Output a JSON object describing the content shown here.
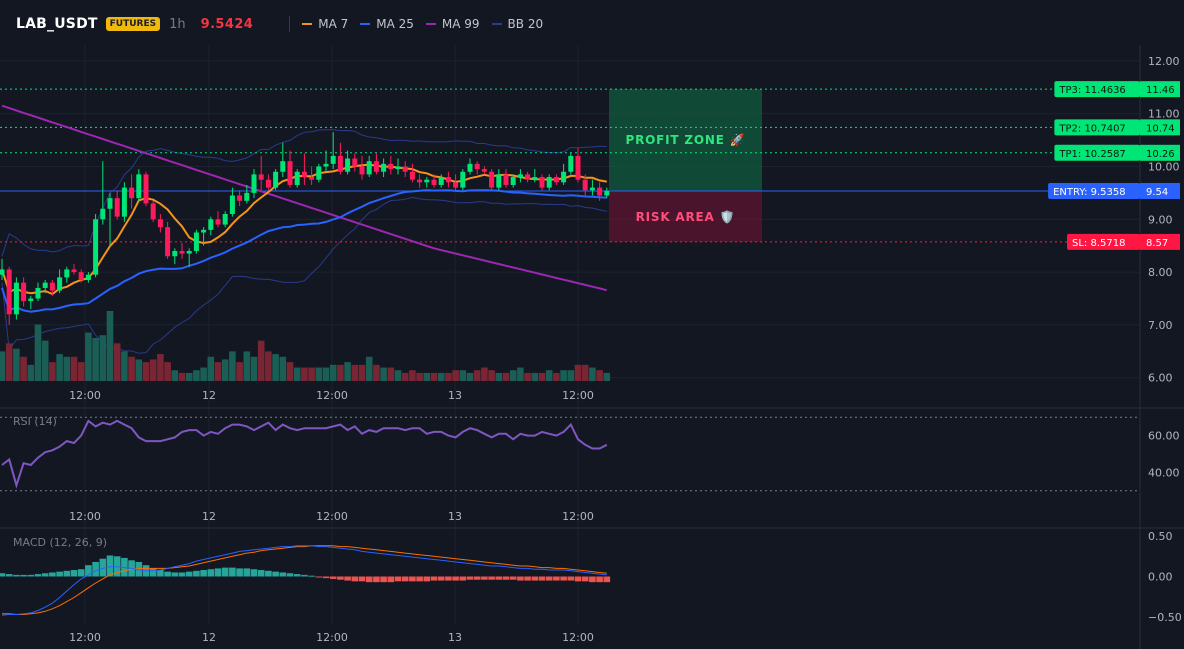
{
  "header": {
    "symbol": "LAB_USDT",
    "badge": "FUTURES",
    "timeframe": "1h",
    "last_price": "9.5424",
    "legend": [
      {
        "label": "MA 7",
        "color": "#f7931a"
      },
      {
        "label": "MA 25",
        "color": "#2962ff"
      },
      {
        "label": "MA 99",
        "color": "#9c27b0"
      },
      {
        "label": "BB 20",
        "color": "#2a3a8c"
      }
    ]
  },
  "colors": {
    "background": "#131722",
    "up": "#26a69a",
    "down": "#f23645",
    "up_bright": "#00e676",
    "down_bright": "#ff1a5c",
    "tp": "#00e676",
    "entry": "#2962ff",
    "sl": "#ff1744"
  },
  "zones": {
    "profit": "PROFIT ZONE 🚀",
    "risk": "RISK AREA 🛡️"
  },
  "levels": [
    {
      "name": "tp3",
      "label": "TP3: 11.4636",
      "value": 11.4636,
      "axis_label": "11.46",
      "kind": "tp"
    },
    {
      "name": "tp2",
      "label": "TP2: 10.7407",
      "value": 10.7407,
      "axis_label": "10.74",
      "kind": "tp"
    },
    {
      "name": "tp1",
      "label": "TP1: 10.2587",
      "value": 10.2587,
      "axis_label": "10.26",
      "kind": "tp"
    },
    {
      "name": "entry",
      "label": "ENTRY: 9.5358",
      "value": 9.5358,
      "axis_label": "9.54",
      "kind": "entry"
    },
    {
      "name": "sl",
      "label": "SL: 8.5718",
      "value": 8.5718,
      "axis_label": "8.57",
      "kind": "sl"
    }
  ],
  "price_axis": {
    "ticks": [
      "12.00",
      "11.00",
      "10.00",
      "9.00",
      "8.00",
      "7.00",
      "6.00"
    ],
    "range": [
      5.9,
      12.3
    ]
  },
  "time_axis": {
    "ticks": [
      "12:00",
      "12",
      "12:00",
      "13",
      "12:00"
    ]
  },
  "rsi": {
    "title": "RSI (14)",
    "ticks": [
      "60.00",
      "40.00"
    ],
    "range": [
      25,
      75
    ],
    "bands": [
      70,
      30
    ]
  },
  "macd": {
    "title": "MACD (12, 26, 9)",
    "ticks": [
      "0.50",
      "0.00",
      "−0.50"
    ],
    "range": [
      -0.6,
      0.6
    ]
  },
  "chart_data": {
    "type": "candlestick",
    "candles": [
      [
        7.95,
        8.25,
        7.85,
        8.05,
        0.55
      ],
      [
        8.05,
        8.1,
        7.0,
        7.2,
        0.7
      ],
      [
        7.2,
        7.9,
        7.1,
        7.8,
        0.6
      ],
      [
        7.8,
        7.9,
        7.35,
        7.45,
        0.45
      ],
      [
        7.45,
        7.55,
        7.3,
        7.5,
        0.3
      ],
      [
        7.5,
        7.8,
        7.45,
        7.7,
        1.05
      ],
      [
        7.7,
        7.85,
        7.6,
        7.8,
        0.75
      ],
      [
        7.8,
        7.85,
        7.55,
        7.65,
        0.35
      ],
      [
        7.65,
        8.05,
        7.6,
        7.9,
        0.5
      ],
      [
        7.9,
        8.1,
        7.8,
        8.05,
        0.45
      ],
      [
        8.05,
        8.15,
        7.95,
        8.0,
        0.45
      ],
      [
        8.0,
        8.05,
        7.8,
        7.85,
        0.35
      ],
      [
        7.85,
        8.0,
        7.8,
        7.95,
        0.9
      ],
      [
        7.95,
        9.1,
        7.9,
        9.0,
        0.8
      ],
      [
        9.0,
        10.1,
        8.9,
        9.2,
        0.85
      ],
      [
        9.2,
        9.5,
        8.5,
        9.4,
        1.3
      ],
      [
        9.4,
        9.55,
        9.0,
        9.05,
        0.7
      ],
      [
        9.05,
        9.7,
        8.95,
        9.6,
        0.55
      ],
      [
        9.6,
        9.85,
        9.2,
        9.4,
        0.45
      ],
      [
        9.4,
        9.95,
        9.35,
        9.85,
        0.4
      ],
      [
        9.85,
        9.9,
        9.25,
        9.3,
        0.35
      ],
      [
        9.3,
        9.35,
        8.95,
        9.0,
        0.4
      ],
      [
        9.0,
        9.1,
        8.75,
        8.85,
        0.5
      ],
      [
        8.85,
        8.95,
        8.25,
        8.3,
        0.35
      ],
      [
        8.3,
        8.45,
        8.15,
        8.4,
        0.2
      ],
      [
        8.4,
        8.55,
        8.25,
        8.35,
        0.15
      ],
      [
        8.35,
        8.45,
        8.1,
        8.4,
        0.15
      ],
      [
        8.4,
        8.8,
        8.35,
        8.75,
        0.2
      ],
      [
        8.75,
        8.85,
        8.5,
        8.8,
        0.25
      ],
      [
        8.8,
        9.05,
        8.7,
        9.0,
        0.45
      ],
      [
        9.0,
        9.15,
        8.85,
        8.9,
        0.35
      ],
      [
        8.9,
        9.15,
        8.85,
        9.1,
        0.4
      ],
      [
        9.1,
        9.6,
        9.05,
        9.45,
        0.55
      ],
      [
        9.45,
        9.55,
        9.25,
        9.35,
        0.35
      ],
      [
        9.35,
        9.65,
        9.3,
        9.5,
        0.55
      ],
      [
        9.5,
        9.95,
        9.4,
        9.85,
        0.45
      ],
      [
        9.85,
        10.2,
        9.55,
        9.75,
        0.75
      ],
      [
        9.75,
        9.85,
        9.55,
        9.6,
        0.55
      ],
      [
        9.6,
        9.95,
        9.55,
        9.9,
        0.5
      ],
      [
        9.9,
        10.45,
        9.8,
        10.1,
        0.45
      ],
      [
        10.1,
        10.3,
        9.6,
        9.65,
        0.35
      ],
      [
        9.65,
        9.95,
        9.6,
        9.9,
        0.25
      ],
      [
        9.9,
        10.25,
        9.65,
        9.8,
        0.25
      ],
      [
        9.8,
        10.0,
        9.65,
        9.75,
        0.25
      ],
      [
        9.75,
        10.05,
        9.7,
        10.0,
        0.25
      ],
      [
        10.0,
        10.3,
        9.9,
        10.05,
        0.25
      ],
      [
        10.05,
        10.65,
        9.95,
        10.2,
        0.3
      ],
      [
        10.2,
        10.45,
        9.85,
        9.9,
        0.3
      ],
      [
        9.9,
        10.3,
        9.85,
        10.15,
        0.35
      ],
      [
        10.15,
        10.25,
        9.9,
        10.0,
        0.3
      ],
      [
        10.0,
        10.2,
        9.75,
        9.85,
        0.3
      ],
      [
        9.85,
        10.2,
        9.8,
        10.1,
        0.45
      ],
      [
        10.1,
        10.25,
        9.85,
        9.9,
        0.3
      ],
      [
        9.9,
        10.15,
        9.8,
        10.05,
        0.25
      ],
      [
        10.05,
        10.2,
        9.85,
        9.95,
        0.25
      ],
      [
        9.95,
        10.15,
        9.85,
        10.0,
        0.2
      ],
      [
        10.0,
        10.1,
        9.8,
        9.9,
        0.15
      ],
      [
        9.9,
        10.05,
        9.7,
        9.75,
        0.2
      ],
      [
        9.75,
        9.85,
        9.6,
        9.7,
        0.15
      ],
      [
        9.7,
        9.8,
        9.6,
        9.75,
        0.15
      ],
      [
        9.75,
        9.85,
        9.6,
        9.65,
        0.15
      ],
      [
        9.65,
        9.85,
        9.6,
        9.8,
        0.15
      ],
      [
        9.8,
        9.9,
        9.6,
        9.7,
        0.15
      ],
      [
        9.7,
        9.85,
        9.55,
        9.6,
        0.2
      ],
      [
        9.6,
        9.95,
        9.55,
        9.9,
        0.2
      ],
      [
        9.9,
        10.15,
        9.85,
        10.05,
        0.15
      ],
      [
        10.05,
        10.1,
        9.85,
        9.95,
        0.2
      ],
      [
        9.95,
        10.0,
        9.85,
        9.9,
        0.25
      ],
      [
        9.9,
        9.95,
        9.55,
        9.6,
        0.2
      ],
      [
        9.6,
        9.95,
        9.55,
        9.85,
        0.15
      ],
      [
        9.85,
        9.95,
        9.6,
        9.65,
        0.15
      ],
      [
        9.65,
        9.85,
        9.6,
        9.8,
        0.2
      ],
      [
        9.8,
        9.95,
        9.7,
        9.85,
        0.25
      ],
      [
        9.85,
        9.9,
        9.7,
        9.75,
        0.15
      ],
      [
        9.75,
        9.95,
        9.7,
        9.8,
        0.15
      ],
      [
        9.8,
        9.85,
        9.55,
        9.6,
        0.15
      ],
      [
        9.6,
        9.85,
        9.55,
        9.8,
        0.2
      ],
      [
        9.8,
        9.85,
        9.65,
        9.7,
        0.15
      ],
      [
        9.7,
        10.05,
        9.65,
        9.9,
        0.2
      ],
      [
        9.9,
        10.25,
        9.85,
        10.2,
        0.2
      ],
      [
        10.2,
        10.35,
        9.7,
        9.75,
        0.3
      ],
      [
        9.75,
        9.85,
        9.45,
        9.55,
        0.3
      ],
      [
        9.55,
        9.75,
        9.45,
        9.6,
        0.25
      ],
      [
        9.6,
        9.7,
        9.35,
        9.45,
        0.2
      ],
      [
        9.45,
        9.6,
        9.4,
        9.54,
        0.15
      ]
    ],
    "rsi": [
      44,
      47,
      33,
      45,
      44,
      48,
      51,
      52,
      54,
      57,
      56,
      60,
      68,
      65,
      67,
      66,
      68,
      66,
      64,
      59,
      57,
      57,
      57,
      58,
      59,
      62,
      63,
      63,
      60,
      62,
      61,
      64,
      66,
      66,
      65,
      63,
      65,
      67,
      63,
      66,
      64,
      63,
      64,
      64,
      64,
      64,
      65,
      66,
      63,
      65,
      61,
      63,
      62,
      64,
      64,
      64,
      63,
      64,
      64,
      61,
      62,
      62,
      60,
      59,
      62,
      64,
      63,
      61,
      59,
      61,
      61,
      58,
      61,
      60,
      60,
      62,
      61,
      60,
      62,
      66,
      58,
      55,
      53,
      53,
      55
    ],
    "macd_hist": [
      0.04,
      0.03,
      0.02,
      0.02,
      0.02,
      0.03,
      0.04,
      0.05,
      0.06,
      0.07,
      0.08,
      0.09,
      0.14,
      0.18,
      0.22,
      0.26,
      0.25,
      0.23,
      0.2,
      0.18,
      0.14,
      0.1,
      0.08,
      0.06,
      0.05,
      0.05,
      0.06,
      0.07,
      0.08,
      0.09,
      0.1,
      0.11,
      0.11,
      0.1,
      0.1,
      0.09,
      0.08,
      0.07,
      0.06,
      0.05,
      0.04,
      0.03,
      0.02,
      0.01,
      -0.01,
      -0.02,
      -0.03,
      -0.04,
      -0.05,
      -0.06,
      -0.06,
      -0.07,
      -0.07,
      -0.07,
      -0.07,
      -0.06,
      -0.06,
      -0.06,
      -0.06,
      -0.06,
      -0.05,
      -0.05,
      -0.05,
      -0.05,
      -0.05,
      -0.04,
      -0.04,
      -0.04,
      -0.04,
      -0.04,
      -0.04,
      -0.04,
      -0.05,
      -0.05,
      -0.05,
      -0.05,
      -0.05,
      -0.05,
      -0.05,
      -0.05,
      -0.06,
      -0.06,
      -0.07,
      -0.07,
      -0.07
    ],
    "macd_line": [
      -0.48,
      -0.47,
      -0.47,
      -0.46,
      -0.45,
      -0.42,
      -0.38,
      -0.33,
      -0.26,
      -0.18,
      -0.1,
      -0.03,
      0.02,
      0.07,
      0.1,
      0.12,
      0.12,
      0.11,
      0.1,
      0.08,
      0.07,
      0.07,
      0.08,
      0.1,
      0.12,
      0.14,
      0.16,
      0.19,
      0.21,
      0.23,
      0.25,
      0.27,
      0.29,
      0.31,
      0.32,
      0.33,
      0.34,
      0.35,
      0.36,
      0.37,
      0.37,
      0.38,
      0.38,
      0.38,
      0.37,
      0.37,
      0.36,
      0.35,
      0.34,
      0.33,
      0.31,
      0.3,
      0.29,
      0.28,
      0.27,
      0.26,
      0.25,
      0.24,
      0.23,
      0.22,
      0.21,
      0.2,
      0.19,
      0.18,
      0.17,
      0.16,
      0.15,
      0.14,
      0.13,
      0.13,
      0.12,
      0.11,
      0.1,
      0.1,
      0.09,
      0.09,
      0.08,
      0.08,
      0.08,
      0.07,
      0.06,
      0.05,
      0.04,
      0.03,
      0.02
    ],
    "signal_line": [
      -0.46,
      -0.46,
      -0.47,
      -0.47,
      -0.46,
      -0.45,
      -0.43,
      -0.4,
      -0.36,
      -0.31,
      -0.26,
      -0.2,
      -0.14,
      -0.08,
      -0.03,
      0.02,
      0.05,
      0.07,
      0.09,
      0.1,
      0.1,
      0.1,
      0.1,
      0.1,
      0.11,
      0.12,
      0.13,
      0.15,
      0.17,
      0.19,
      0.21,
      0.23,
      0.25,
      0.27,
      0.29,
      0.3,
      0.32,
      0.33,
      0.34,
      0.35,
      0.36,
      0.37,
      0.37,
      0.38,
      0.38,
      0.38,
      0.38,
      0.37,
      0.37,
      0.36,
      0.35,
      0.34,
      0.33,
      0.32,
      0.31,
      0.3,
      0.29,
      0.28,
      0.27,
      0.26,
      0.25,
      0.24,
      0.23,
      0.22,
      0.21,
      0.2,
      0.19,
      0.18,
      0.17,
      0.16,
      0.15,
      0.14,
      0.13,
      0.13,
      0.12,
      0.11,
      0.11,
      0.1,
      0.1,
      0.09,
      0.08,
      0.07,
      0.06,
      0.05,
      0.04
    ]
  }
}
